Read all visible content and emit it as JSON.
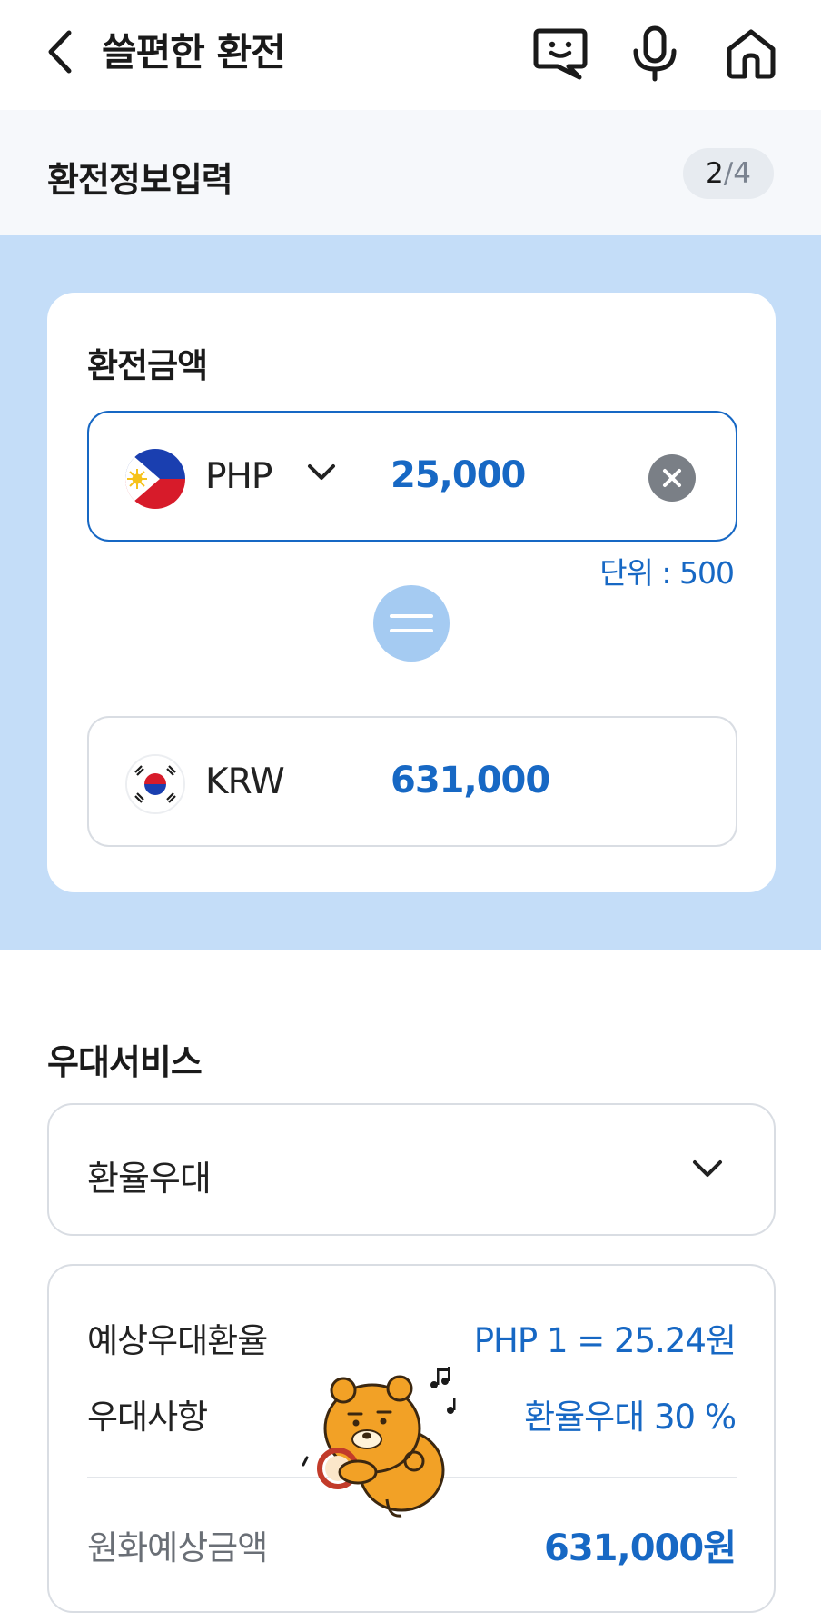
{
  "header": {
    "title": "쓸편한 환전",
    "icons": [
      "chevron-left-icon",
      "chat-bubble-icon",
      "microphone-icon",
      "home-icon"
    ]
  },
  "step": {
    "title": "환전정보입력",
    "current": "2",
    "separator": "/",
    "total": "4"
  },
  "exchange": {
    "title": "환전금액",
    "from": {
      "currency": "PHP",
      "amount": "25,000",
      "flag": "philippines-flag"
    },
    "unit_note": "단위 : 500",
    "to": {
      "currency": "KRW",
      "amount": "631,000",
      "flag": "korea-flag"
    }
  },
  "benefit": {
    "title": "우대서비스",
    "selected": "환율우대",
    "rows": [
      {
        "label": "예상우대환율",
        "value": "PHP 1 = 25.24원"
      },
      {
        "label": "우대사항",
        "value": "환율우대 30 %"
      }
    ],
    "total_label": "원화예상금액",
    "total_value": "631,000원"
  },
  "colors": {
    "accent": "#1768c4",
    "section_bg": "#c4ddf8",
    "stepbar_bg": "#f6f8fb"
  }
}
